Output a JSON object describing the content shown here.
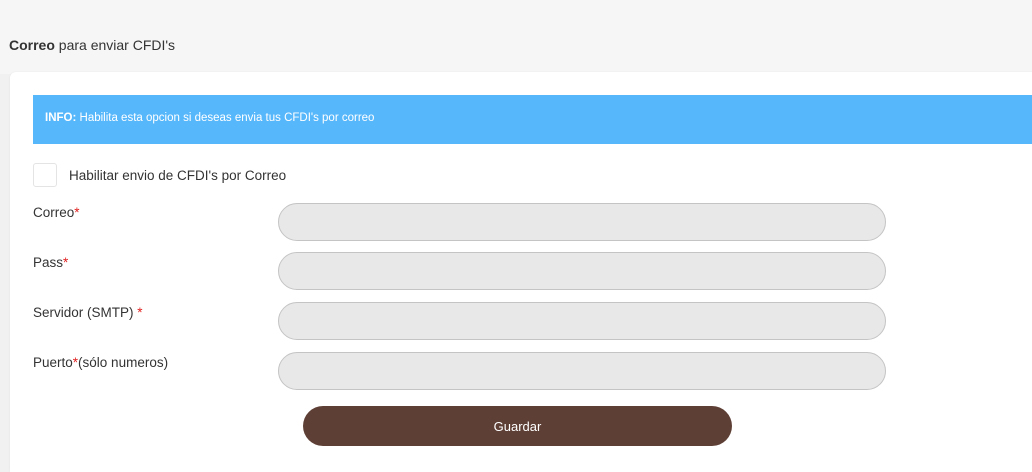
{
  "header": {
    "title_bold": "Correo",
    "title_rest": " para enviar CFDI's"
  },
  "info": {
    "prefix": "INFO:",
    "message": " Habilita esta opcion si deseas envia tus CFDI's por correo"
  },
  "enable_email": {
    "label": "Habilitar envio de CFDI's por Correo",
    "checked": false
  },
  "fields": [
    {
      "label": "Correo",
      "required_mark": "*",
      "suffix": "",
      "value": ""
    },
    {
      "label": "Pass",
      "required_mark": "*",
      "suffix": "",
      "value": ""
    },
    {
      "label": "Servidor (SMTP) ",
      "required_mark": "*",
      "suffix": "",
      "value": ""
    },
    {
      "label": "Puerto",
      "required_mark": "*",
      "suffix": "(sólo numeros)",
      "value": ""
    }
  ],
  "actions": {
    "save_label": "Guardar"
  },
  "colors": {
    "info_banner": "#57b7fb",
    "save_button": "#5e3f35",
    "required_mark": "#e02020"
  }
}
